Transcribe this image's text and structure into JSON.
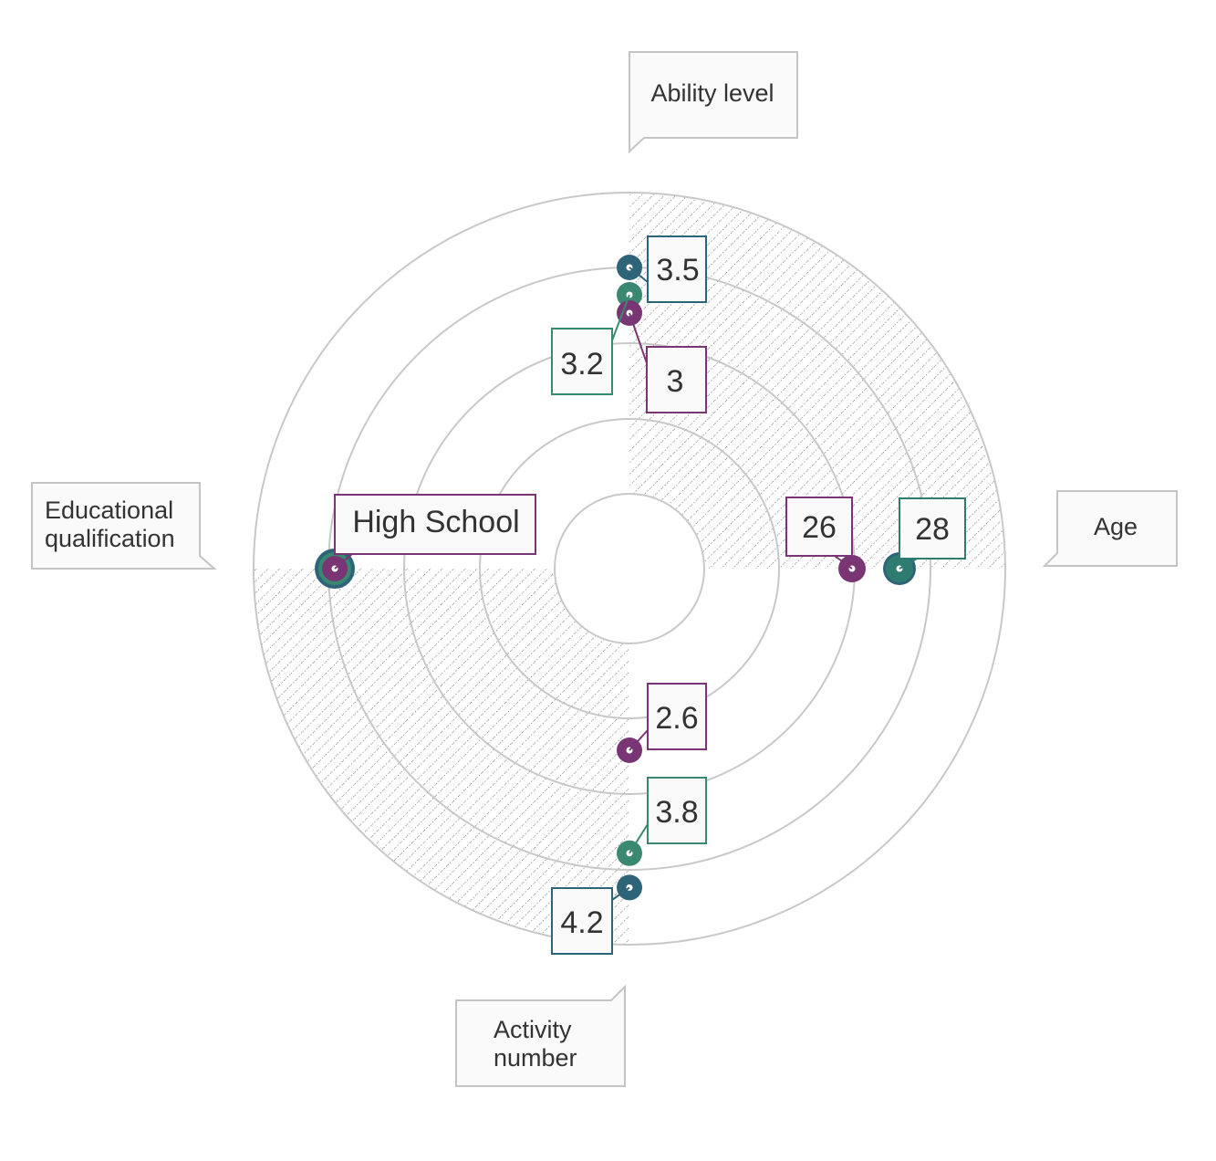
{
  "chart_data": {
    "type": "polar",
    "axes": [
      {
        "label": [
          "Ability level"
        ],
        "direction": "top"
      },
      {
        "label": [
          "Age"
        ],
        "direction": "right"
      },
      {
        "label": [
          "Activity",
          "number"
        ],
        "direction": "bottom"
      },
      {
        "label": [
          "Educational",
          "qualification"
        ],
        "direction": "left"
      }
    ],
    "series": [
      {
        "color": "#2e6478",
        "values": {
          "Ability level": 3.5,
          "Age": 28,
          "Activity number": 4.2,
          "Educational qualification": "High School"
        }
      },
      {
        "color": "#3b8872",
        "values": {
          "Ability level": 3.2,
          "Age": 28,
          "Activity number": 3.8,
          "Educational qualification": "High School"
        }
      },
      {
        "color": "#7a3674",
        "values": {
          "Ability level": 3,
          "Age": 26,
          "Activity number": 2.6,
          "Educational qualification": "High School"
        }
      }
    ],
    "labels": [
      {
        "text": "3.5",
        "color": "#2e6478"
      },
      {
        "text": "3.2",
        "color": "#3b8872"
      },
      {
        "text": "3",
        "color": "#7a3674"
      },
      {
        "text": "26",
        "color": "#7a3674"
      },
      {
        "text": "28",
        "color": "#2e7b70"
      },
      {
        "text": "2.6",
        "color": "#7a3674"
      },
      {
        "text": "3.8",
        "color": "#3b8872"
      },
      {
        "text": "4.2",
        "color": "#2e6478"
      },
      {
        "text": "High School",
        "color": "#7a3674"
      }
    ],
    "rings": 5,
    "hatched_quadrants": [
      "top-right",
      "bottom-left"
    ],
    "grid": true,
    "legend": "none"
  }
}
